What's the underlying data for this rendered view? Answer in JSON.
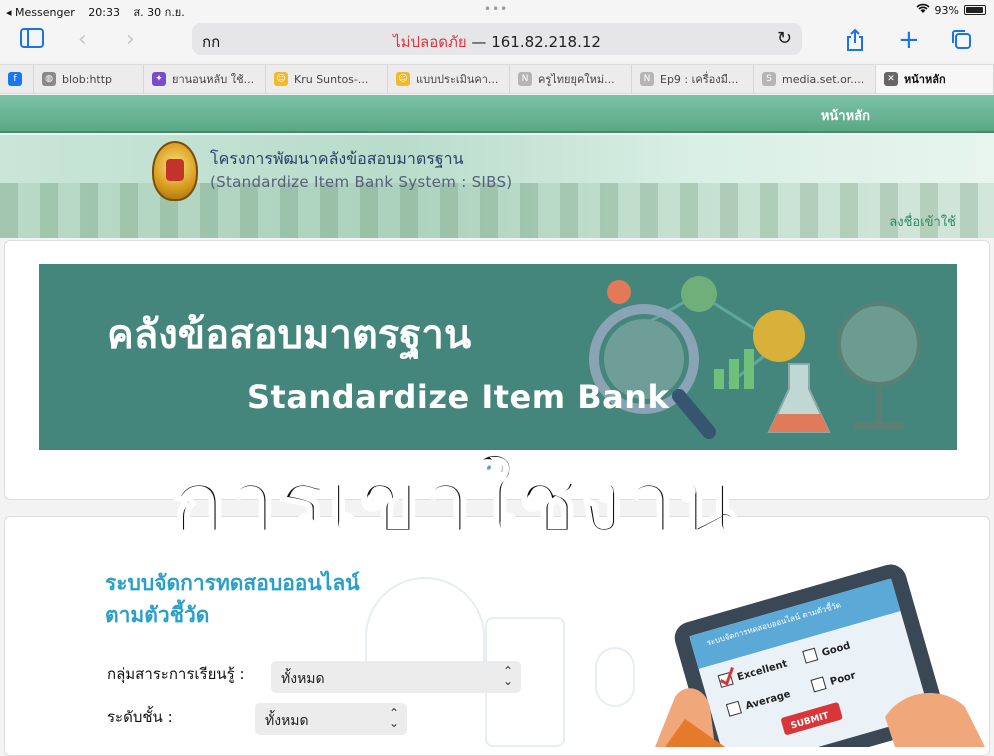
{
  "status": {
    "back_app": "◂ Messenger",
    "time": "20:33",
    "date": "ส. 30 ก.ย.",
    "battery": "93%",
    "battery_level": 0.93
  },
  "browser": {
    "text_size": "กก",
    "insecure_label": "ไม่ปลอดภัย",
    "separator": " — ",
    "url": "161.82.218.12"
  },
  "tabs": [
    {
      "label": "",
      "icon": "facebook-icon",
      "color": "#1877f2",
      "glyph": "f"
    },
    {
      "label": "blob:http",
      "icon": "globe-icon",
      "color": "#8a8a8a",
      "glyph": "◍"
    },
    {
      "label": "ยานอนหลับ ใช้...",
      "icon": "purple-app-icon",
      "color": "#7b4cc9",
      "glyph": "✦"
    },
    {
      "label": "Kru Suntos-...",
      "icon": "smiley-icon",
      "color": "#f1b92b",
      "glyph": "☺"
    },
    {
      "label": "แบบประเมินคา...",
      "icon": "smiley-icon",
      "color": "#f1b92b",
      "glyph": "☺"
    },
    {
      "label": "ครูไทยยุคใหม่...",
      "icon": "n-letter-icon",
      "color": "#b5b5b5",
      "glyph": "N"
    },
    {
      "label": "Ep9 : เครื่องมื...",
      "icon": "n-letter-icon",
      "color": "#b5b5b5",
      "glyph": "N"
    },
    {
      "label": "media.set.or....",
      "icon": "s-letter-icon",
      "color": "#b5b5b5",
      "glyph": "S"
    },
    {
      "label": "หน้าหลัก",
      "icon": "close-tab-icon",
      "color": "#666666",
      "glyph": "✕",
      "active": true
    }
  ],
  "site": {
    "nav_home": "หน้าหลัก",
    "title_th": "โครงการพัฒนาคลังข้อสอบมาตรฐาน",
    "title_en": "(Standardize Item Bank System : SIBS)",
    "login": "ลงชื่อเข้าใช้"
  },
  "carousel": {
    "heading_th": "คลังข้อสอบมาตรฐาน",
    "heading_en": "Standardize Item Bank"
  },
  "overlay_title": "การเข้าใช้งาน",
  "section": {
    "title_line1": "ระบบจัดการทดสอบออนไลน์",
    "title_line2": "ตามตัวชี้วัด",
    "subject_label": "กลุ่มสาระการเรียนรู้ :",
    "subject_value": "ทั้งหมด",
    "level_label": "ระดับชั้น :",
    "level_value": "ทั้งหมด"
  },
  "tablet": {
    "screen_title": "ระบบจัดการทดสอบออนไลน์ ตามตัวชี้วัด",
    "opt1": "Excellent",
    "opt2": "Good",
    "opt3": "Average",
    "opt4": "Poor",
    "submit": "SUBMIT"
  },
  "colors": {
    "nav_green": "#5aa886",
    "slide_teal": "#45867c",
    "insecure_red": "#e0363a",
    "accent_blue": "#1a73e8"
  }
}
